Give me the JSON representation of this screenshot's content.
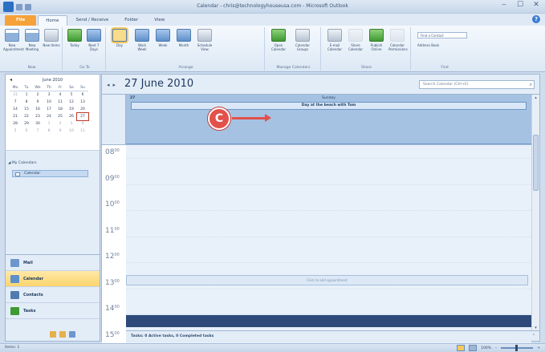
{
  "window": {
    "title": "Calendar - chris@technologyhouseusa.com - Microsoft Outlook",
    "controls": [
      "‒",
      "☐",
      "✕"
    ]
  },
  "ribbon_tabs": [
    "File",
    "Home",
    "Send / Receive",
    "Folder",
    "View"
  ],
  "ribbon": {
    "groups": [
      {
        "label": "New",
        "buttons": [
          "New Appointment",
          "New Meeting",
          "New Items"
        ]
      },
      {
        "label": "Go To",
        "buttons": [
          "Today",
          "Next 7 Days"
        ]
      },
      {
        "label": "Arrange",
        "buttons": [
          "Day",
          "Work Week",
          "Week",
          "Month",
          "Schedule View"
        ]
      },
      {
        "label": "Manage Calendars",
        "buttons": [
          "Open Calendar",
          "Calendar Groups"
        ]
      },
      {
        "label": "Share",
        "buttons": [
          "E-mail Calendar",
          "Share Calendar",
          "Publish Online",
          "Calendar Permissions"
        ]
      },
      {
        "label": "Find",
        "find_contact": "Find a Contact",
        "address_book": "Address Book"
      }
    ]
  },
  "mini_calendar": {
    "month": "June 2010",
    "days_of_week": [
      "Mo",
      "Tu",
      "We",
      "Th",
      "Fr",
      "Sa",
      "Su"
    ],
    "weeks": [
      [
        "31",
        "1",
        "2",
        "3",
        "4",
        "5",
        "6"
      ],
      [
        "7",
        "8",
        "9",
        "10",
        "11",
        "12",
        "13"
      ],
      [
        "14",
        "15",
        "16",
        "17",
        "18",
        "19",
        "20"
      ],
      [
        "21",
        "22",
        "23",
        "24",
        "25",
        "26",
        "27"
      ],
      [
        "28",
        "29",
        "30",
        "1",
        "2",
        "3",
        "4"
      ],
      [
        "5",
        "6",
        "7",
        "8",
        "9",
        "10",
        "11"
      ]
    ],
    "today": "27"
  },
  "my_calendars": {
    "title": "My Calendars",
    "items": [
      "Calendar"
    ]
  },
  "modules": [
    "Mail",
    "Calendar",
    "Contacts",
    "Tasks"
  ],
  "calendar": {
    "date_title": "27 June 2010",
    "search_placeholder": "Search Calendar (Ctrl+E)",
    "day_number": "27",
    "day_name": "Sunday",
    "all_day_event": "Day at the beach with Tom",
    "hours": [
      {
        "h": "08",
        "m": "00"
      },
      {
        "h": "09",
        "m": "00"
      },
      {
        "h": "10",
        "m": "00"
      },
      {
        "h": "11",
        "m": "00"
      },
      {
        "h": "12",
        "m": "00"
      },
      {
        "h": "13",
        "m": "00"
      },
      {
        "h": "14",
        "m": "00"
      },
      {
        "h": "15",
        "m": "00"
      }
    ],
    "click_to_add": "Click to add appointment",
    "tasks_bar": "Tasks: 0 Active tasks, 0 Completed tasks"
  },
  "status_bar": {
    "items": "Items: 1",
    "zoom": "100%"
  },
  "callout": {
    "letter": "C",
    "color": "#e2514a"
  }
}
